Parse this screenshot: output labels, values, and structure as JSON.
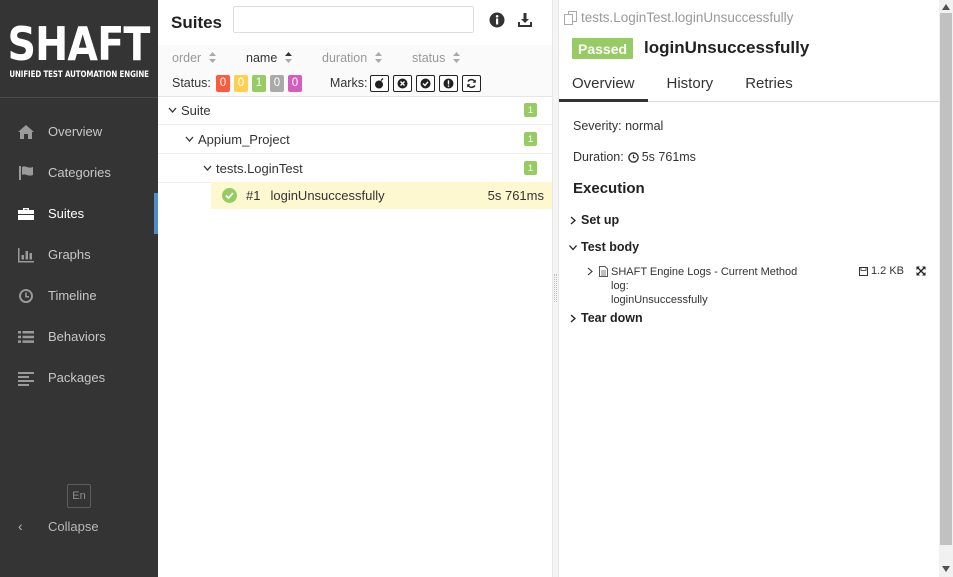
{
  "sidebar": {
    "logo_title": "SHAFT",
    "logo_subtitle": "UNIFIED TEST AUTOMATION ENGINE",
    "items": [
      {
        "label": "Overview",
        "icon": "home-icon"
      },
      {
        "label": "Categories",
        "icon": "flag-icon"
      },
      {
        "label": "Suites",
        "icon": "briefcase-icon"
      },
      {
        "label": "Graphs",
        "icon": "bar-chart-icon"
      },
      {
        "label": "Timeline",
        "icon": "clock-icon"
      },
      {
        "label": "Behaviors",
        "icon": "list-icon"
      },
      {
        "label": "Packages",
        "icon": "align-left-icon"
      }
    ],
    "active_item": "Suites",
    "language": "En",
    "collapse_label": "Collapse"
  },
  "suites": {
    "title": "Suites",
    "search": {
      "value": "",
      "placeholder": ""
    },
    "sort": {
      "order": "order",
      "name": "name",
      "duration": "duration",
      "status": "status"
    },
    "status_label": "Status:",
    "status_counts": [
      {
        "value": "0",
        "color": "#fd5a3e"
      },
      {
        "value": "0",
        "color": "#ffd050"
      },
      {
        "value": "1",
        "color": "#97cc64"
      },
      {
        "value": "0",
        "color": "#aaaaaa"
      },
      {
        "value": "0",
        "color": "#d35ebe"
      }
    ],
    "marks_label": "Marks:",
    "tree": {
      "suite": {
        "label": "Suite",
        "count": "1"
      },
      "project": {
        "label": "Appium_Project",
        "count": "1"
      },
      "class": {
        "label": "tests.LoginTest",
        "count": "1"
      },
      "test": {
        "number": "#1",
        "name": "loginUnsuccessfully",
        "duration": "5s 761ms"
      }
    }
  },
  "detail": {
    "breadcrumb": "tests.LoginTest.loginUnsuccessfully",
    "status": "Passed",
    "status_color": "#97cc64",
    "title": "loginUnsuccessfully",
    "tabs": [
      "Overview",
      "History",
      "Retries"
    ],
    "severity": "Severity: normal",
    "duration_label": "Duration:",
    "duration_value": "5s 761ms",
    "execution_title": "Execution",
    "steps": {
      "setup": "Set up",
      "body": "Test body",
      "teardown": "Tear down"
    },
    "attachment": {
      "name_line1": "SHAFT Engine Logs - Current Method log:",
      "name_line2": "loginUnsuccessfully",
      "size": "1.2 KB"
    }
  }
}
